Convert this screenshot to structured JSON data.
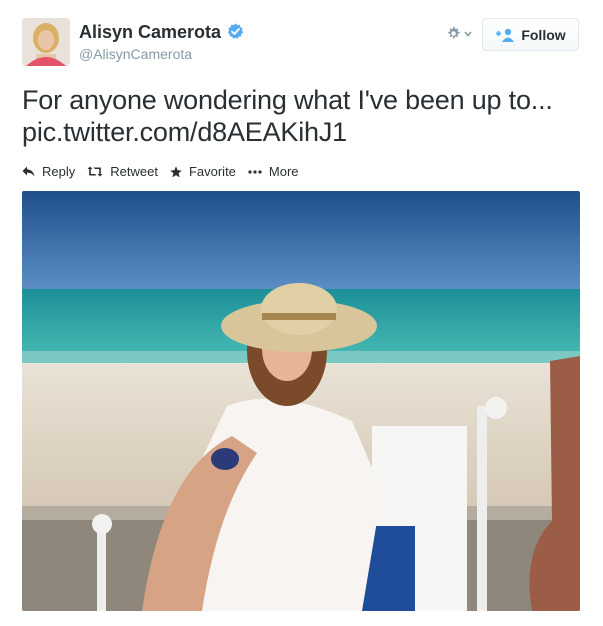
{
  "author": {
    "name": "Alisyn Camerota",
    "handle": "@AlisynCamerota",
    "verified": true
  },
  "header": {
    "follow_label": "Follow",
    "settings_icon": "gear-icon"
  },
  "tweet": {
    "text_line1": "For anyone wondering what I've been up to...",
    "text_line2": "pic.twitter.com/d8AEAKihJ1"
  },
  "actions": [
    {
      "label": "Reply",
      "icon": "reply-icon"
    },
    {
      "label": "Retweet",
      "icon": "retweet-icon"
    },
    {
      "label": "Favorite",
      "icon": "star-icon"
    },
    {
      "label": "More",
      "icon": "more-icon"
    }
  ],
  "colors": {
    "verified_blue": "#55acee",
    "follow_icon_blue": "#55acee",
    "text": "#292f33",
    "muted": "#8899a6"
  }
}
